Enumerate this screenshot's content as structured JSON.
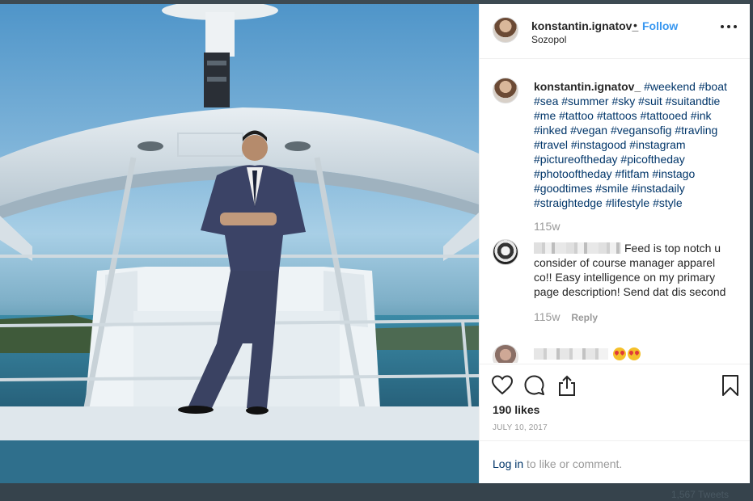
{
  "post": {
    "username": "konstantin.ignatov_",
    "dot": "•",
    "follow_label": "Follow",
    "location": "Sozopol"
  },
  "caption": {
    "username": "konstantin.ignatov_",
    "hashtags": "#weekend #boat #sea #summer #sky #suit #suitandtie #me #tattoo #tattoos #tattooed #ink #inked #vegan #vegansofig #travling #travel #instagood #instagram #pictureoftheday #picoftheday #photooftheday #fitfam #instago #goodtimes #smile #instadaily #straightedge #lifestyle #style",
    "time": "115w"
  },
  "comment1": {
    "text": "Feed is top notch u consider of course manager apparel co!! Easy intelligence on my primary page description! Send dat dis second",
    "time": "115w",
    "reply_label": "Reply"
  },
  "comment2": {
    "emoji": "heart-eyes"
  },
  "actions": {
    "likes": "190 likes",
    "date": "JULY 10, 2017"
  },
  "login": {
    "link_label": "Log in",
    "rest": " to like or comment."
  },
  "footer": {
    "faded_text": "1,567 Tweets"
  },
  "colors": {
    "follow": "#3897f0",
    "hashtag": "#003569",
    "muted": "#999999",
    "text": "#262626"
  }
}
